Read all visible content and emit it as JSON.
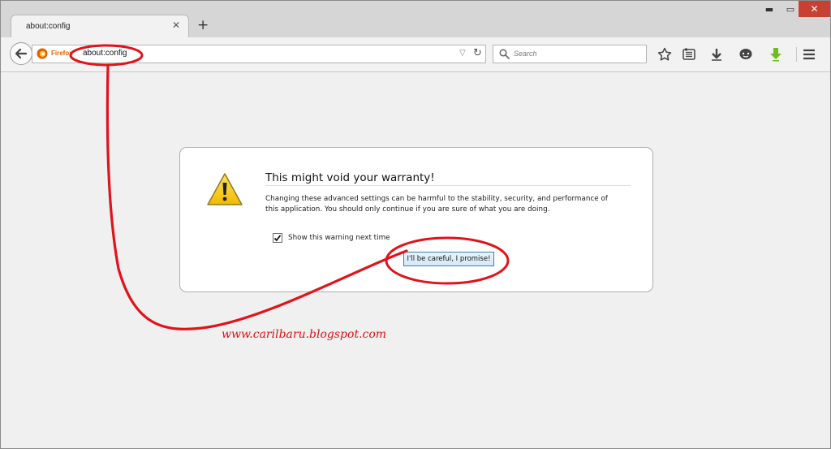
{
  "window": {
    "minimize_glyph": "▬",
    "maximize_glyph": "▭",
    "close_glyph": "✕"
  },
  "tab": {
    "title": "about:config",
    "close_glyph": "✕"
  },
  "new_tab_glyph": "+",
  "navbar": {
    "identity_label": "Firefox",
    "url": "about:config",
    "search_placeholder": "Search",
    "icons": [
      "back-icon",
      "firefox-logo-icon",
      "dropdown-arrow-icon",
      "reload-icon",
      "search-icon",
      "bookmark-star-icon",
      "reading-list-icon",
      "download-arrow-icon",
      "chat-icon",
      "download-green-icon",
      "menu-icon"
    ]
  },
  "warning": {
    "title": "This might void your warranty!",
    "description": "Changing these advanced settings can be harmful to the stability, security, and performance of this application. You should only continue if you are sure of what you are doing.",
    "checkbox_label": "Show this warning next time",
    "checkbox_checked": true,
    "button_label": "I'll be careful, I promise!"
  },
  "watermark": "www.carilbaru.blogspot.com",
  "colors": {
    "annotation": "#e0131b",
    "window_close": "#c84031",
    "firefox_orange": "#e66000",
    "download_green": "#6cbe1d"
  }
}
